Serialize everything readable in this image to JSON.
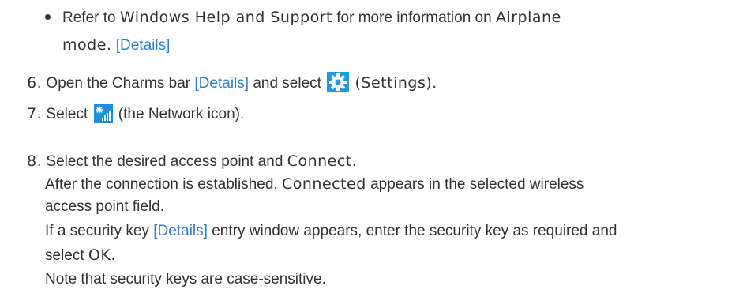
{
  "bullet": {
    "refer": "Refer to",
    "help": "Windows Help and Support",
    "more": "for more information on",
    "airplane": "Airplane",
    "mode": "mode.",
    "details": "[Details]"
  },
  "steps": [
    {
      "number": "6.",
      "t1": "Open the Charms bar",
      "details": "[Details]",
      "t2": "and select",
      "icon": "settings-gear-icon",
      "settings": "(Settings).",
      "t3": ""
    },
    {
      "number": "7.",
      "t1": "Select",
      "icon": "network-icon",
      "t2": "(the Network icon)."
    },
    {
      "number": "8.",
      "t1": "Select the desired access point and",
      "connect": "Connect.",
      "p1a": "After the connection is established,",
      "connected": "Connected",
      "p1b": "appears in the selected wireless",
      "p1c": "access point field.",
      "p2a": "If a security key",
      "details": "[Details]",
      "p2b": "entry window appears, enter the security key as required and",
      "p2c": "select",
      "ok": "OK.",
      "p3": "Note that security keys are case-sensitive."
    }
  ],
  "colors": {
    "link": "#2e7fd0",
    "text": "#333333",
    "gear_bg": "#1f9be5",
    "network_bg": "#1c8fdc"
  }
}
